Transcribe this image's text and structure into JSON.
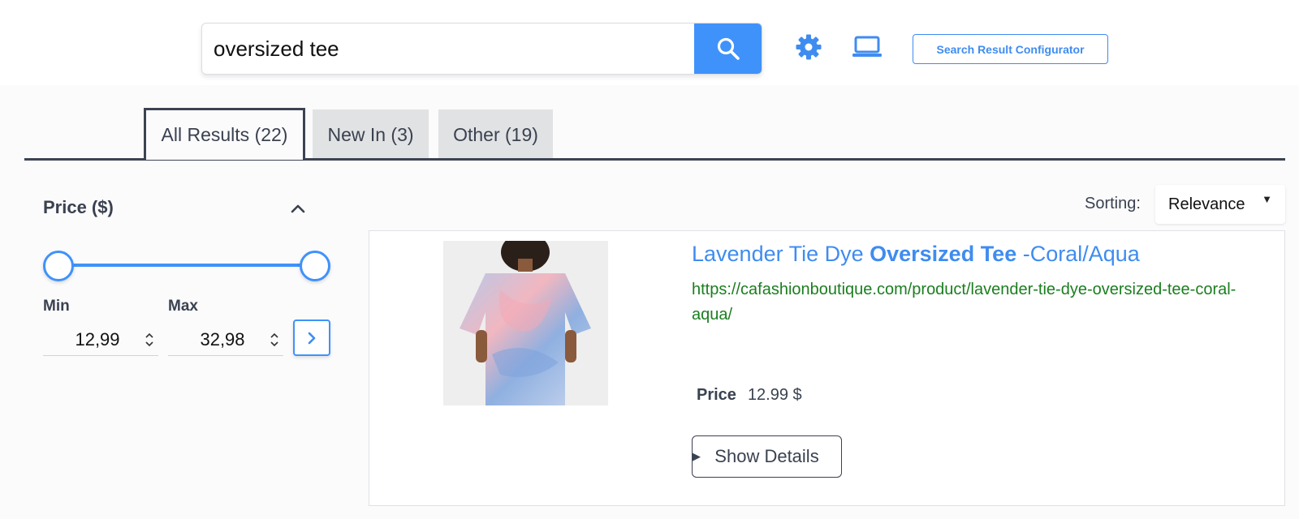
{
  "search": {
    "query": "oversized tee",
    "search_icon": "search-icon"
  },
  "toolbar": {
    "settings_icon": "gear-icon",
    "device_icon": "laptop-icon",
    "configurator_label": "Search Result Configurator"
  },
  "tabs": [
    {
      "label": "All Results (22)",
      "active": true
    },
    {
      "label": "New In (3)",
      "active": false
    },
    {
      "label": "Other (19)",
      "active": false
    }
  ],
  "filter": {
    "title": "Price ($)",
    "collapse_icon": "chevron-up-icon",
    "min_label": "Min",
    "max_label": "Max",
    "min_value": "12,99",
    "max_value": "32,98",
    "apply_icon": "chevron-right-icon"
  },
  "sorting": {
    "label": "Sorting:",
    "selected": "Relevance"
  },
  "result": {
    "title_prefix": "Lavender Tie Dye ",
    "title_highlight": "Oversized Tee",
    "title_suffix": " -Coral/Aqua",
    "url": "https://cafashionboutique.com/product/lavender-tie-dye-oversized-tee-coral-aqua/",
    "price_label": "Price",
    "price_value": "12.99 $",
    "details_label": "Show Details"
  },
  "colors": {
    "accent": "#3f92fa",
    "link": "#3f8cf0",
    "url_green": "#1b7e1f",
    "text": "#3a4150"
  }
}
